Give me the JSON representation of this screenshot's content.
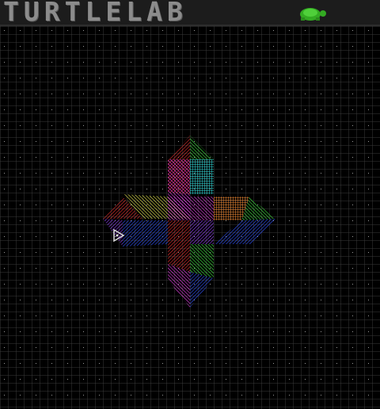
{
  "app": {
    "title": "TURTLELAB",
    "icon": "turtle-icon",
    "accent": "#33aa22"
  },
  "canvas": {
    "background": "#000000",
    "grid_color": "#3a3a3a",
    "grid_dot_color": "#9a9a9a",
    "turtle": {
      "icon": "turtle-cursor-icon",
      "heading": "east",
      "color": "#dddddd"
    },
    "drawing_colors": [
      "#dd3333",
      "#33dd33",
      "#3355ee",
      "#ee33ee",
      "#33dddd",
      "#ffee33",
      "#ee8833",
      "#8833ee"
    ]
  }
}
